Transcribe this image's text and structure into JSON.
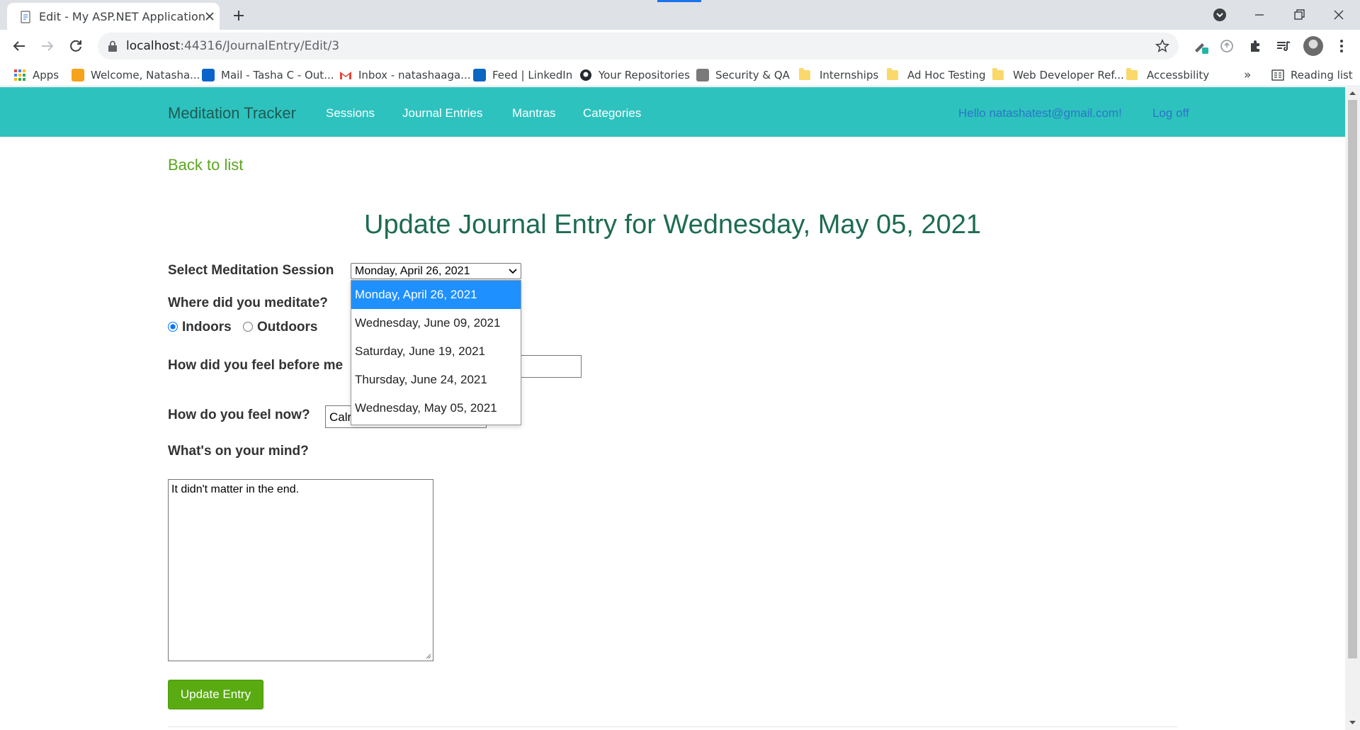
{
  "browser": {
    "tab_title": "Edit - My ASP.NET Application",
    "url_host": "localhost",
    "url_path": ":44316/JournalEntry/Edit/3",
    "bookmarks": [
      {
        "label": "Apps"
      },
      {
        "label": "Welcome, Natasha..."
      },
      {
        "label": "Mail - Tasha C - Out..."
      },
      {
        "label": "Inbox - natashaaga..."
      },
      {
        "label": "Feed | LinkedIn"
      },
      {
        "label": "Your Repositories"
      },
      {
        "label": "Security & QA"
      },
      {
        "label": "Internships"
      },
      {
        "label": "Ad Hoc Testing"
      },
      {
        "label": "Web Developer Ref..."
      },
      {
        "label": "Accessbility"
      }
    ],
    "overflow_label": "»",
    "reading_list": "Reading list"
  },
  "navbar": {
    "brand": "Meditation Tracker",
    "links": [
      "Sessions",
      "Journal Entries",
      "Mantras",
      "Categories"
    ],
    "greeting": "Hello natashatest@gmail.com!",
    "logoff": "Log off"
  },
  "page": {
    "back_link": "Back to list",
    "title": "Update Journal Entry for Wednesday, May 05, 2021"
  },
  "form": {
    "session_label": "Select Meditation Session",
    "session_value": "Monday, April 26, 2021",
    "session_options": [
      "Monday, April 26, 2021",
      "Wednesday, June 09, 2021",
      "Saturday, June 19, 2021",
      "Thursday, June 24, 2021",
      "Wednesday, May 05, 2021"
    ],
    "location_label": "Where did you meditate?",
    "indoors_label": "Indoors",
    "outdoors_label": "Outdoors",
    "location_selected": "Indoors",
    "feel_before_label": "How did you feel before me",
    "feel_before_value": "",
    "feel_now_label": "How do you feel now?",
    "feel_now_value": "Calr",
    "mind_label": "What's on your mind?",
    "mind_value": "It didn't matter in the end.",
    "submit_label": "Update Entry"
  },
  "colors": {
    "navbar_bg": "#2ec2bf",
    "brand": "#1d5b52",
    "title": "#1d6b53",
    "link_green": "#5aa61e",
    "button_bg": "#5aaa12",
    "option_highlight": "#1e90ff"
  }
}
